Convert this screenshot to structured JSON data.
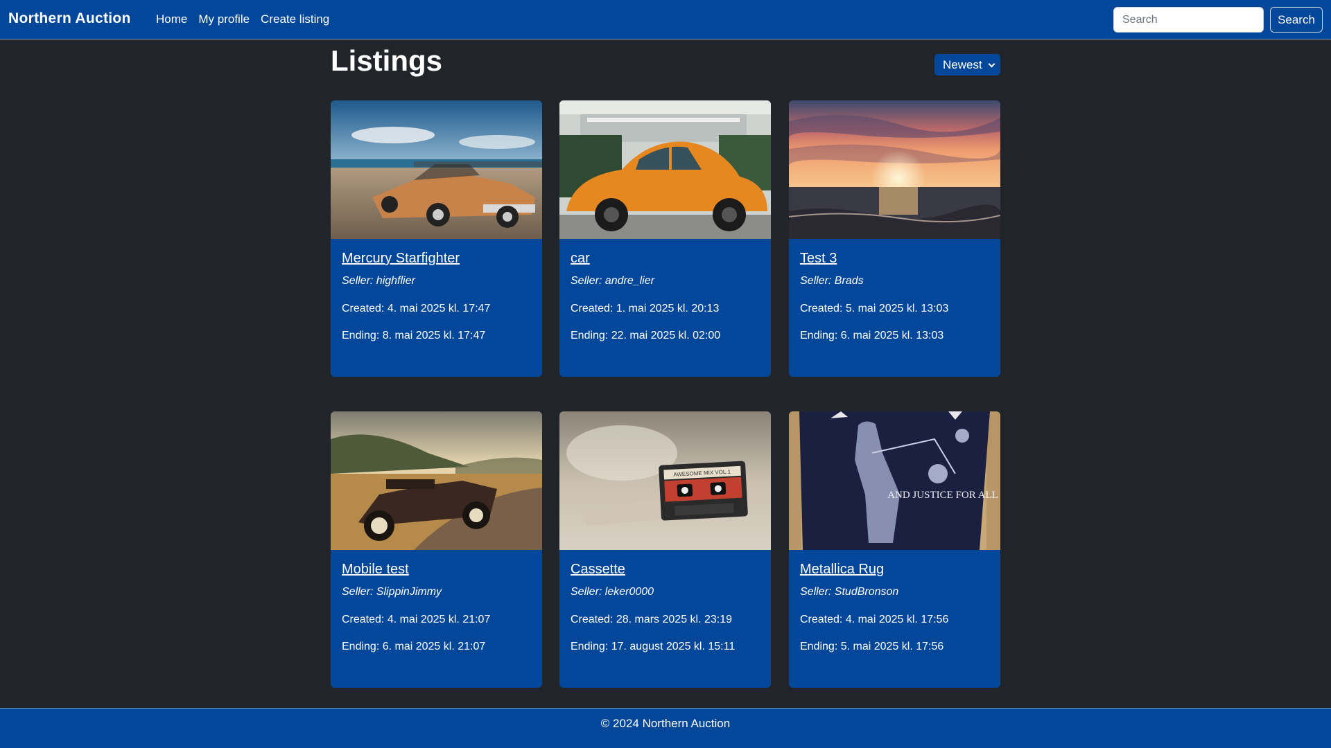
{
  "navbar": {
    "brand": "Northern Auction",
    "links": [
      "Home",
      "My profile",
      "Create listing"
    ],
    "search_placeholder": "Search",
    "search_button": "Search"
  },
  "main": {
    "title": "Listings",
    "sort_selected": "Newest"
  },
  "listings": [
    {
      "title": "Mercury Starfighter",
      "seller": "Seller: highflier",
      "created": "Created: 4. mai 2025 kl. 17:47",
      "ending": "Ending: 8. mai 2025 kl. 17:47",
      "image": "vintage-convertible-coast"
    },
    {
      "title": "car",
      "seller": "Seller: andre_lier",
      "created": "Created: 1. mai 2025 kl. 20:13",
      "ending": "Ending: 22. mai 2025 kl. 02:00",
      "image": "orange-beetle"
    },
    {
      "title": "Test 3",
      "seller": "Seller: Brads",
      "created": "Created: 5. mai 2025 kl. 13:03",
      "ending": "Ending: 6. mai 2025 kl. 13:03",
      "image": "sunset-sea"
    },
    {
      "title": "Mobile test",
      "seller": "Seller: SlippinJimmy",
      "created": "Created: 4. mai 2025 kl. 21:07",
      "ending": "Ending: 6. mai 2025 kl. 21:07",
      "image": "classic-car-road"
    },
    {
      "title": "Cassette",
      "seller": "Seller: leker0000",
      "created": "Created: 28. mars 2025 kl. 23:19",
      "ending": "Ending: 17. august 2025 kl. 15:11",
      "image": "cassette-tape",
      "image_text": "AWESOME MIX VOL.1"
    },
    {
      "title": "Metallica Rug",
      "seller": "Seller: StudBronson",
      "created": "Created: 4. mai 2025 kl. 17:56",
      "ending": "Ending: 5. mai 2025 kl. 17:56",
      "image": "metallica-rug",
      "image_text": "AND JUSTICE FOR ALL"
    }
  ],
  "footer": {
    "text": "© 2024 Northern Auction"
  },
  "colors": {
    "primary": "#03479a",
    "background": "#212529"
  }
}
